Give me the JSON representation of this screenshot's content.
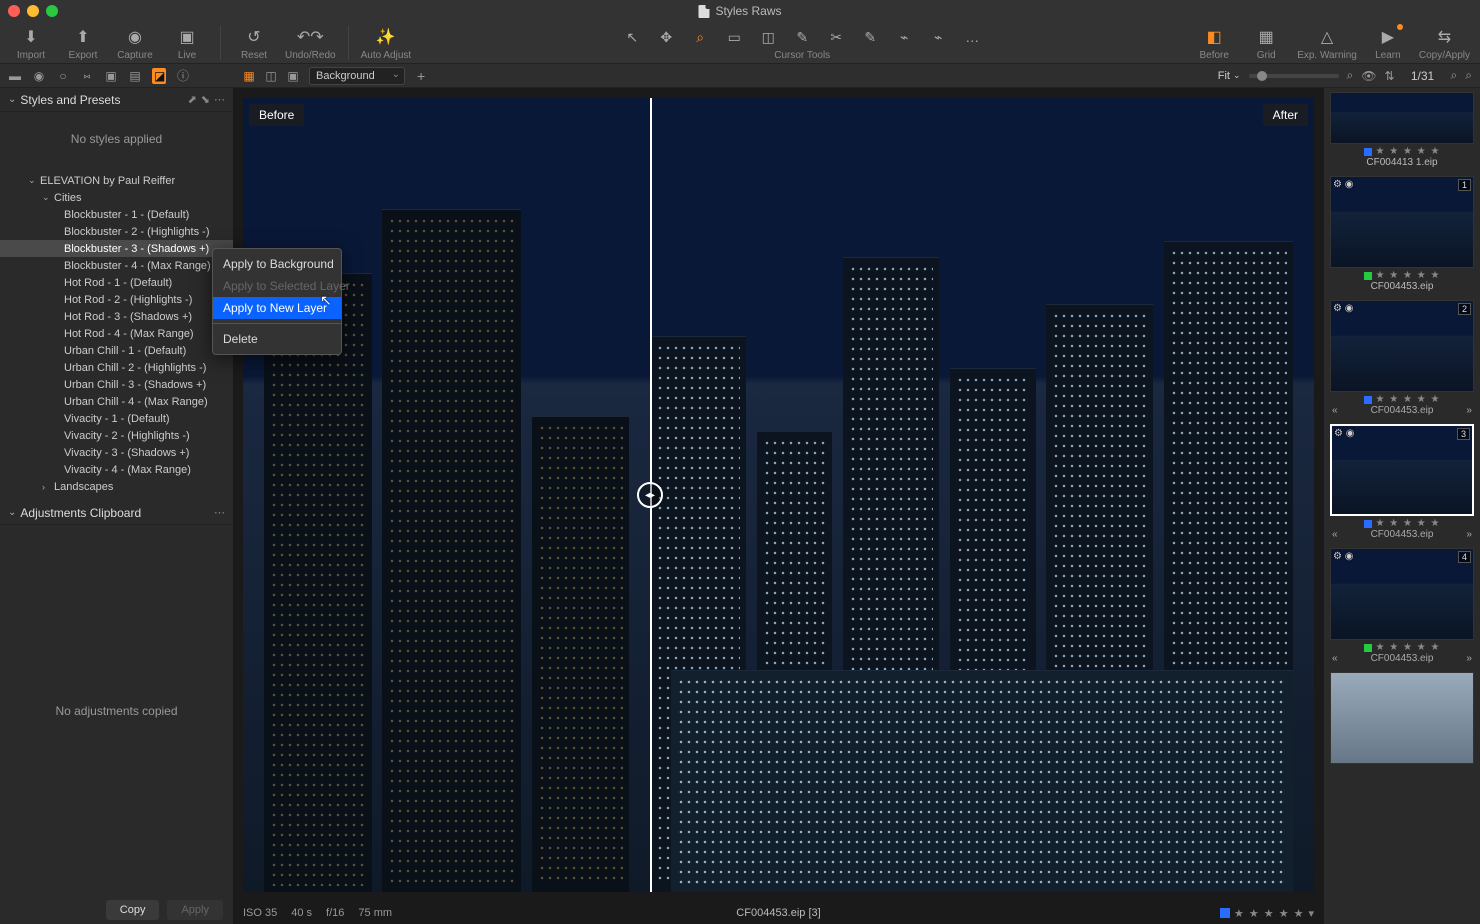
{
  "window": {
    "title": "Styles Raws"
  },
  "toolbar": {
    "left": [
      {
        "id": "import",
        "label": "Import",
        "glyph": "⬇"
      },
      {
        "id": "export",
        "label": "Export",
        "glyph": "⬆"
      },
      {
        "id": "capture",
        "label": "Capture",
        "glyph": "◉"
      },
      {
        "id": "live",
        "label": "Live",
        "glyph": "▣"
      }
    ],
    "mid1": [
      {
        "id": "reset",
        "label": "Reset",
        "glyph": "↺"
      },
      {
        "id": "undoredo",
        "label": "Undo/Redo",
        "glyph": "↶↷"
      }
    ],
    "mid2": [
      {
        "id": "autoadjust",
        "label": "Auto Adjust",
        "glyph": "✨"
      }
    ],
    "cursor_tools_label": "Cursor Tools",
    "cursor_tools": [
      "↖",
      "✥",
      "⌕",
      "▭",
      "◫",
      "✎",
      "✂",
      "✎",
      "⌁",
      "⌁ ",
      "…"
    ],
    "cursor_active_index": 2,
    "right": [
      {
        "id": "before",
        "label": "Before",
        "glyph": "◧",
        "orange": true
      },
      {
        "id": "grid",
        "label": "Grid",
        "glyph": "▦"
      },
      {
        "id": "expwarn",
        "label": "Exp. Warning",
        "glyph": "△"
      },
      {
        "id": "learn",
        "label": "Learn",
        "glyph": "▶",
        "badge": true
      },
      {
        "id": "copyapply",
        "label": "Copy/Apply",
        "glyph": "⇆"
      }
    ]
  },
  "secondbar": {
    "left_icons": [
      "▬",
      "◉",
      "○",
      "⑅",
      "▣",
      "▤",
      "◪",
      "ⓘ"
    ],
    "left_active_index": 6,
    "view_modes": [
      "▦",
      "◫",
      "▣"
    ],
    "view_active_index": 0,
    "layer_dropdown": "Background",
    "fit_label": "Fit",
    "counter": "1/31"
  },
  "panels": {
    "styles": {
      "title": "Styles and Presets",
      "empty_msg": "No styles applied",
      "tree": {
        "root": "ELEVATION by Paul Reiffer",
        "groups": [
          {
            "name": "Cities",
            "expanded": true,
            "items": [
              "Blockbuster - 1 - (Default)",
              "Blockbuster - 2 - (Highlights -)",
              "Blockbuster - 3 - (Shadows +)",
              "Blockbuster - 4 - (Max Range)",
              "Hot Rod - 1 - (Default)",
              "Hot Rod - 2 - (Highlights -)",
              "Hot Rod - 3 - (Shadows +)",
              "Hot Rod - 4 - (Max Range)",
              "Urban Chill - 1 - (Default)",
              "Urban Chill - 2 - (Highlights -)",
              "Urban Chill - 3 - (Shadows +)",
              "Urban Chill - 4 - (Max Range)",
              "Vivacity - 1 - (Default)",
              "Vivacity - 2 - (Highlights -)",
              "Vivacity - 3 - (Shadows +)",
              "Vivacity - 4 - (Max Range)"
            ],
            "selected_index": 2
          },
          {
            "name": "Landscapes",
            "expanded": false,
            "items": []
          }
        ]
      }
    },
    "adjustments": {
      "title": "Adjustments Clipboard",
      "empty_msg": "No adjustments copied",
      "copy_btn": "Copy",
      "apply_btn": "Apply"
    }
  },
  "context_menu": {
    "items": [
      {
        "label": "Apply to Background",
        "state": "normal"
      },
      {
        "label": "Apply to Selected Layer",
        "state": "disabled"
      },
      {
        "label": "Apply to New Layer",
        "state": "highlight"
      },
      {
        "sep": true
      },
      {
        "label": "Delete",
        "state": "normal"
      }
    ]
  },
  "viewer": {
    "before_label": "Before",
    "after_label": "After",
    "exif": {
      "iso": "ISO 35",
      "shutter": "40 s",
      "aperture": "f/16",
      "focal": "75 mm"
    },
    "filename": "CF004453.eip [3]",
    "rating_stars": "★ ★ ★ ★ ★",
    "tag_color": "#2a6cff"
  },
  "browser": {
    "thumbs": [
      {
        "name": "CF004413 1.eip",
        "num": "",
        "tag": "blue",
        "nav": false,
        "sel": false,
        "first": true
      },
      {
        "name": "CF004453.eip",
        "num": "1",
        "tag": "green",
        "nav": false,
        "sel": false
      },
      {
        "name": "CF004453.eip",
        "num": "2",
        "tag": "blue",
        "nav": true,
        "sel": false
      },
      {
        "name": "CF004453.eip",
        "num": "3",
        "tag": "blue",
        "nav": true,
        "sel": true
      },
      {
        "name": "CF004453.eip",
        "num": "4",
        "tag": "green",
        "nav": true,
        "sel": false
      },
      {
        "name": "",
        "num": "",
        "tag": "",
        "nav": false,
        "sel": false,
        "proc": true
      }
    ],
    "stars": "★ ★ ★ ★ ★",
    "nav_prev": "«",
    "nav_next": "»"
  }
}
